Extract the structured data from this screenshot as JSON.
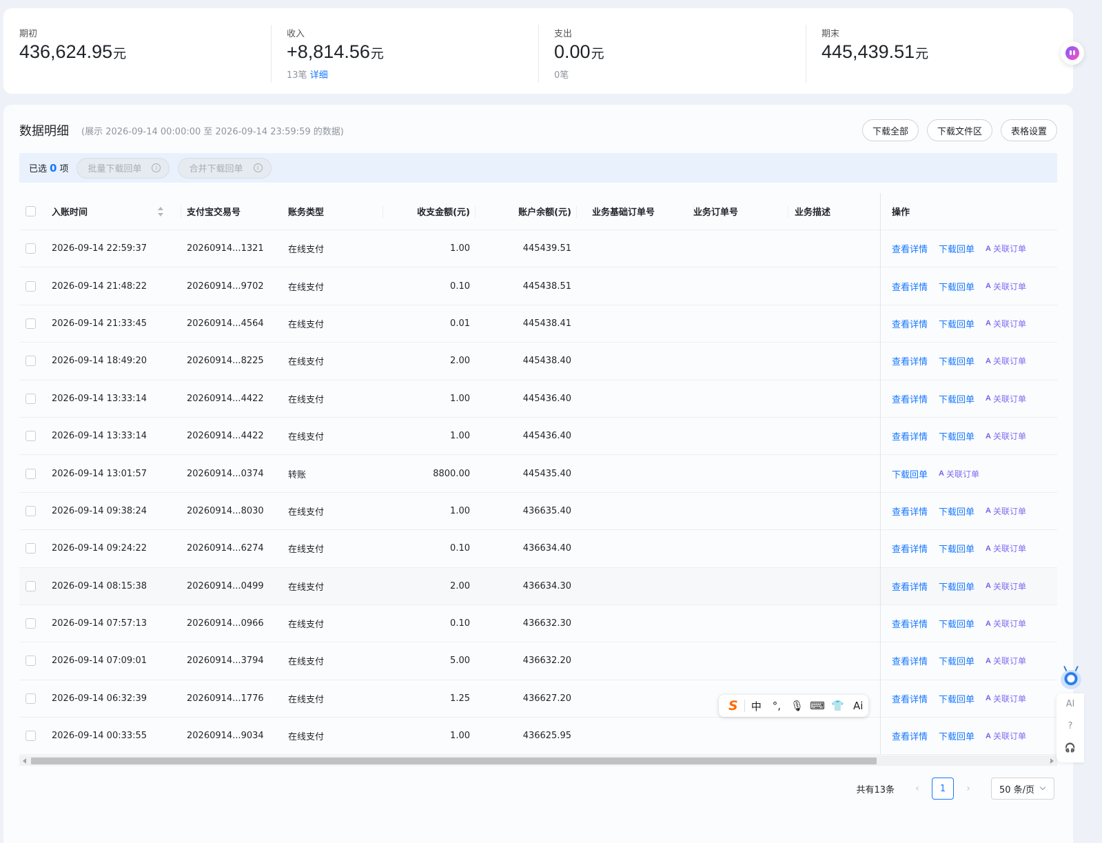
{
  "summary": {
    "opening": {
      "label": "期初",
      "amount": "436,624.95",
      "unit": "元"
    },
    "income": {
      "label": "收入",
      "amount": "+8,814.56",
      "unit": "元",
      "count": "13笔",
      "detail_link": "详细"
    },
    "expense": {
      "label": "支出",
      "amount": "0.00",
      "unit": "元",
      "count": "0笔"
    },
    "closing": {
      "label": "期末",
      "amount": "445,439.51",
      "unit": "元"
    }
  },
  "details": {
    "title": "数据明细",
    "range_note": "(展示 2026-09-14 00:00:00 至 2026-09-14 23:59:59 的数据)",
    "buttons": {
      "download_all": "下载全部",
      "download_area": "下载文件区",
      "table_settings": "表格设置"
    }
  },
  "selection": {
    "prefix": "已选",
    "count": "0",
    "suffix": "项",
    "batch_download": "批量下载回单",
    "merge_download": "合并下载回单",
    "info_glyph": "i"
  },
  "table": {
    "headers": {
      "time": "入账时间",
      "trade_no": "支付宝交易号",
      "type": "账务类型",
      "amount": "收支金额(元)",
      "balance": "账户余额(元)",
      "base_order": "业务基础订单号",
      "order": "业务订单号",
      "desc": "业务描述",
      "ops": "操作"
    },
    "ops_labels": {
      "view": "查看详情",
      "download": "下载回单",
      "link_order": "关联订单",
      "ai_glyph": "A"
    },
    "rows": [
      {
        "time": "2026-09-14 22:59:37",
        "trade_no": "20260914...1321",
        "type": "在线支付",
        "amount": "1.00",
        "balance": "445439.51",
        "view": "查看详情",
        "download": "下载回单",
        "link": "关联订单"
      },
      {
        "time": "2026-09-14 21:48:22",
        "trade_no": "20260914...9702",
        "type": "在线支付",
        "amount": "0.10",
        "balance": "445438.51",
        "view": "查看详情",
        "download": "下载回单",
        "link": "关联订单"
      },
      {
        "time": "2026-09-14 21:33:45",
        "trade_no": "20260914...4564",
        "type": "在线支付",
        "amount": "0.01",
        "balance": "445438.41",
        "view": "查看详情",
        "download": "下载回单",
        "link": "关联订单"
      },
      {
        "time": "2026-09-14 18:49:20",
        "trade_no": "20260914...8225",
        "type": "在线支付",
        "amount": "2.00",
        "balance": "445438.40",
        "view": "查看详情",
        "download": "下载回单",
        "link": "关联订单"
      },
      {
        "time": "2026-09-14 13:33:14",
        "trade_no": "20260914...4422",
        "type": "在线支付",
        "amount": "1.00",
        "balance": "445436.40",
        "view": "查看详情",
        "download": "下载回单",
        "link": "关联订单"
      },
      {
        "time": "2026-09-14 13:33:14",
        "trade_no": "20260914...4422",
        "type": "在线支付",
        "amount": "1.00",
        "balance": "445436.40",
        "view": "查看详情",
        "download": "下载回单",
        "link": "关联订单"
      },
      {
        "time": "2026-09-14 13:01:57",
        "trade_no": "20260914...0374",
        "type": "转账",
        "amount": "8800.00",
        "balance": "445435.40",
        "view": "",
        "download": "下载回单",
        "link": "关联订单"
      },
      {
        "time": "2026-09-14 09:38:24",
        "trade_no": "20260914...8030",
        "type": "在线支付",
        "amount": "1.00",
        "balance": "436635.40",
        "view": "查看详情",
        "download": "下载回单",
        "link": "关联订单"
      },
      {
        "time": "2026-09-14 09:24:22",
        "trade_no": "20260914...6274",
        "type": "在线支付",
        "amount": "0.10",
        "balance": "436634.40",
        "view": "查看详情",
        "download": "下载回单",
        "link": "关联订单"
      },
      {
        "time": "2026-09-14 08:15:38",
        "trade_no": "20260914...0499",
        "type": "在线支付",
        "amount": "2.00",
        "balance": "436634.30",
        "view": "查看详情",
        "download": "下载回单",
        "link": "关联订单"
      },
      {
        "time": "2026-09-14 07:57:13",
        "trade_no": "20260914...0966",
        "type": "在线支付",
        "amount": "0.10",
        "balance": "436632.30",
        "view": "查看详情",
        "download": "下载回单",
        "link": "关联订单"
      },
      {
        "time": "2026-09-14 07:09:01",
        "trade_no": "20260914...3794",
        "type": "在线支付",
        "amount": "5.00",
        "balance": "436632.20",
        "view": "查看详情",
        "download": "下载回单",
        "link": "关联订单"
      },
      {
        "time": "2026-09-14 06:32:39",
        "trade_no": "20260914...1776",
        "type": "在线支付",
        "amount": "1.25",
        "balance": "436627.20",
        "view": "查看详情",
        "download": "下载回单",
        "link": "关联订单"
      },
      {
        "time": "2026-09-14 00:33:55",
        "trade_no": "20260914...9034",
        "type": "在线支付",
        "amount": "1.00",
        "balance": "436625.95",
        "view": "查看详情",
        "download": "下载回单",
        "link": "关联订单"
      }
    ]
  },
  "pagination": {
    "total": "共有13条",
    "prev": "‹",
    "page": "1",
    "next": "›",
    "page_size": "50 条/页"
  },
  "ime_toolbar": {
    "logo": "S",
    "mode": "中",
    "punct": "°,",
    "mic": "🎙",
    "keyboard": "⌨",
    "skin": "👕",
    "ai": "Ai"
  },
  "right_rail": {
    "ai": "AI",
    "help": "?",
    "service": "🎧"
  },
  "colors": {
    "accent": "#1677ff",
    "ai_link": "#7b6df2",
    "select_bar": "#e9f1fd",
    "page_bg": "#eef2f8"
  }
}
